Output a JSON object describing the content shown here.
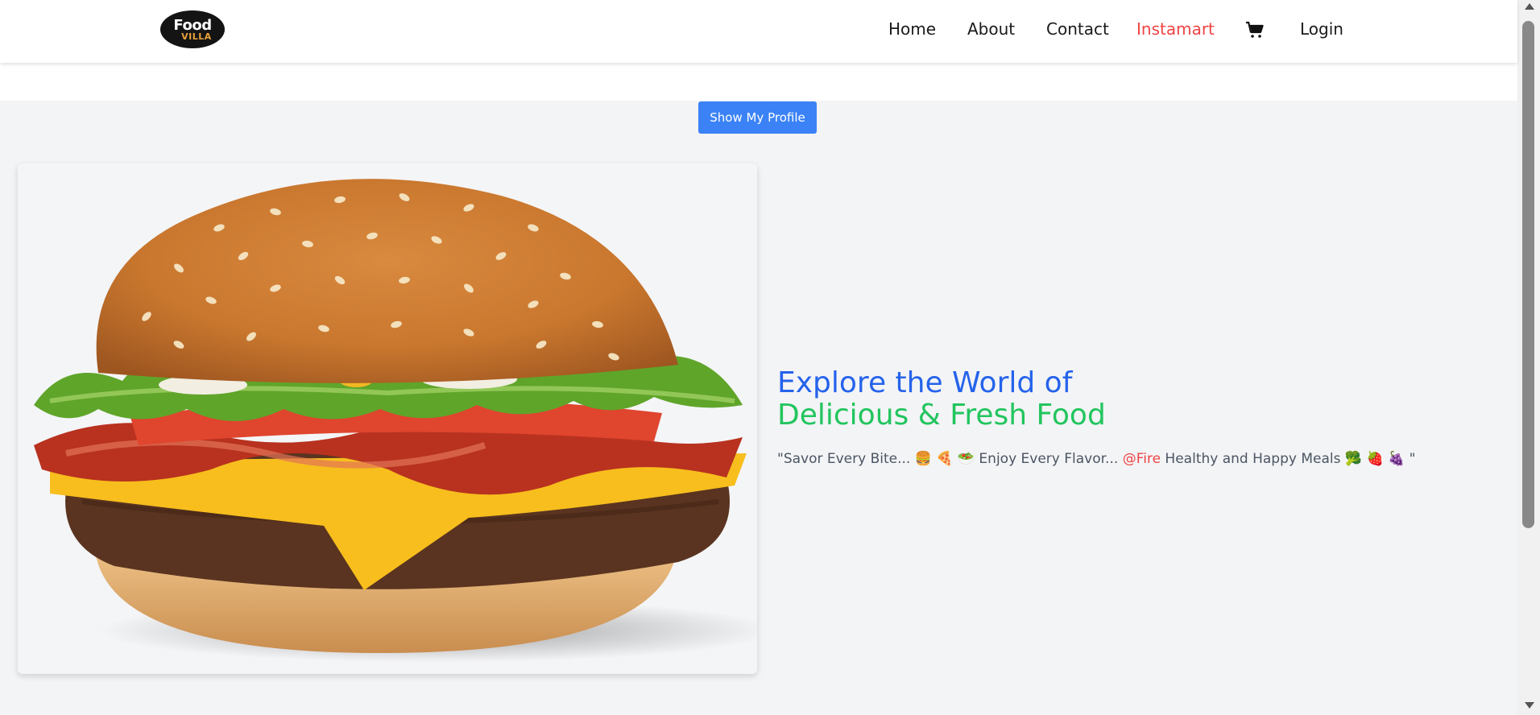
{
  "header": {
    "logo": {
      "line1": "Food",
      "line2": "VILLA"
    },
    "nav": [
      {
        "label": "Home"
      },
      {
        "label": "About"
      },
      {
        "label": "Contact"
      },
      {
        "label": "Instamart"
      },
      {
        "label": "Login"
      }
    ],
    "cart_icon": "cart-icon"
  },
  "main": {
    "profile_button": "Show My Profile",
    "hero": {
      "title_line1": "Explore the World of",
      "title_line2": "Delicious & Fresh Food",
      "tagline_start": "\"Savor Every Bite... 🍔 🍕 🥗 Enjoy Every Flavor... ",
      "tagline_fire": "@Fire",
      "tagline_end": " Healthy and Happy Meals 🥦 🍓 🍇 \""
    }
  },
  "colors": {
    "accent_blue": "#2563eb",
    "accent_green": "#22c55e",
    "active_nav": "#ef4444",
    "button": "#3b82f6"
  }
}
